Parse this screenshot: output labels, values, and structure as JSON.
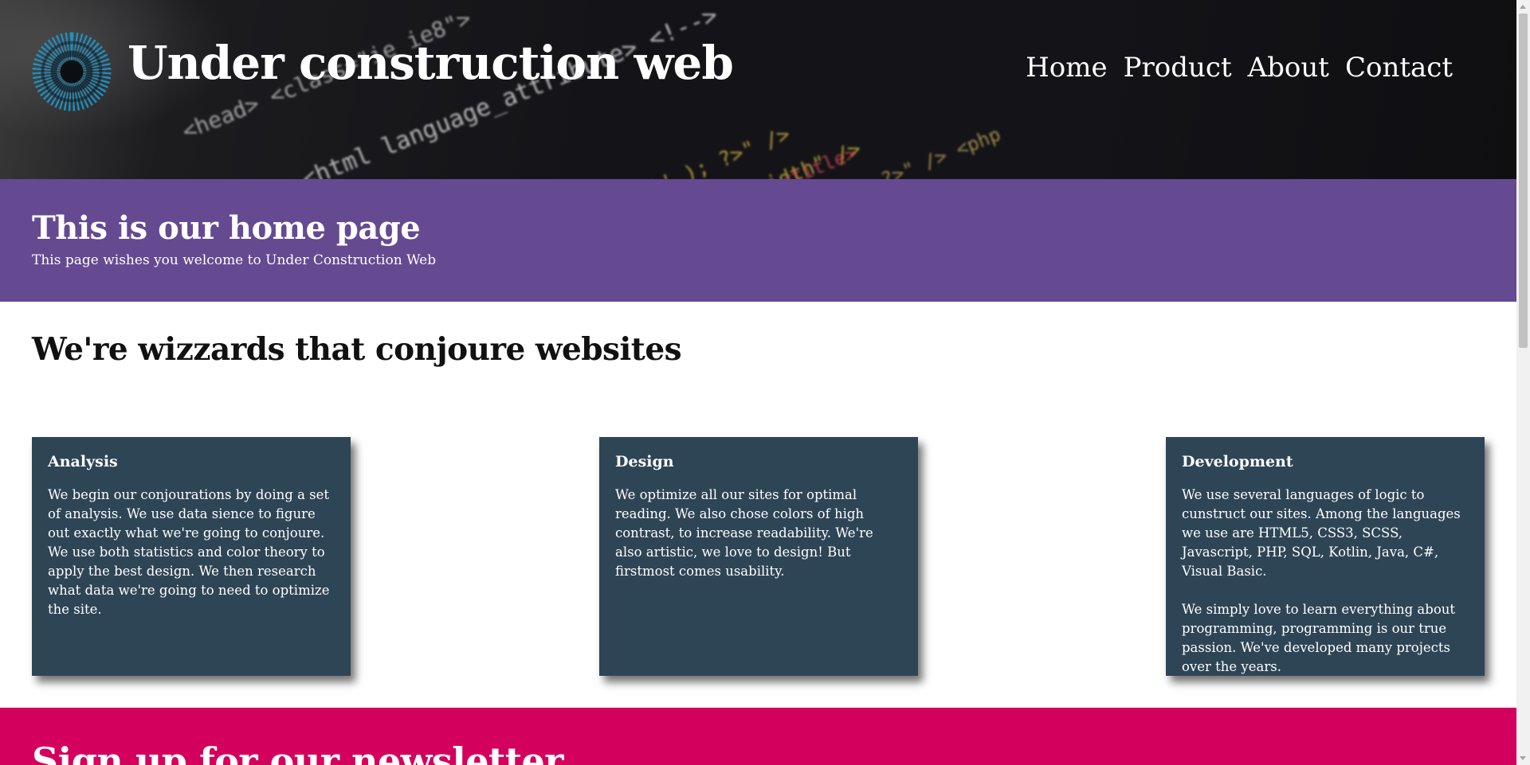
{
  "header": {
    "site_title": "Under construction web",
    "logo_icon": "radial-dots-logo-icon",
    "nav": [
      {
        "label": "Home"
      },
      {
        "label": "Product"
      },
      {
        "label": "About"
      },
      {
        "label": "Contact"
      }
    ]
  },
  "hero": {
    "title": "This is our home page",
    "subtitle": "This page wishes you welcome to Under Construction Web"
  },
  "intro": {
    "heading": "We're wizzards that conjoure websites"
  },
  "cards": [
    {
      "title": "Analysis",
      "paragraphs": [
        "We begin our conjourations by doing a set of analysis. We use data sience to figure out exactly what we're going to conjoure. We use both statistics and color theory to apply the best design. We then research what data we're going to need to optimize the site."
      ]
    },
    {
      "title": "Design",
      "paragraphs": [
        "We optimize all our sites for optimal reading. We also chose colors of high contrast, to increase readability. We're also artistic, we love to design! But firstmost comes usability."
      ]
    },
    {
      "title": "Development",
      "paragraphs": [
        "We use several languages of logic to cunstruct our sites. Among the languages we use are HTML5, CSS3, SCSS, Javascript, PHP, SQL, Kotlin, Java, C#, Visual Basic.",
        "We simply love to learn everything about programming, programming is our true passion. We've developed many projects over the years."
      ]
    }
  ],
  "newsletter": {
    "title": "Sign up for our newsletter"
  },
  "colors": {
    "hero_bg": "#654a92",
    "card_bg": "#2e4556",
    "newsletter_bg": "#d4005e",
    "logo_accent": "#1d8fc0"
  }
}
